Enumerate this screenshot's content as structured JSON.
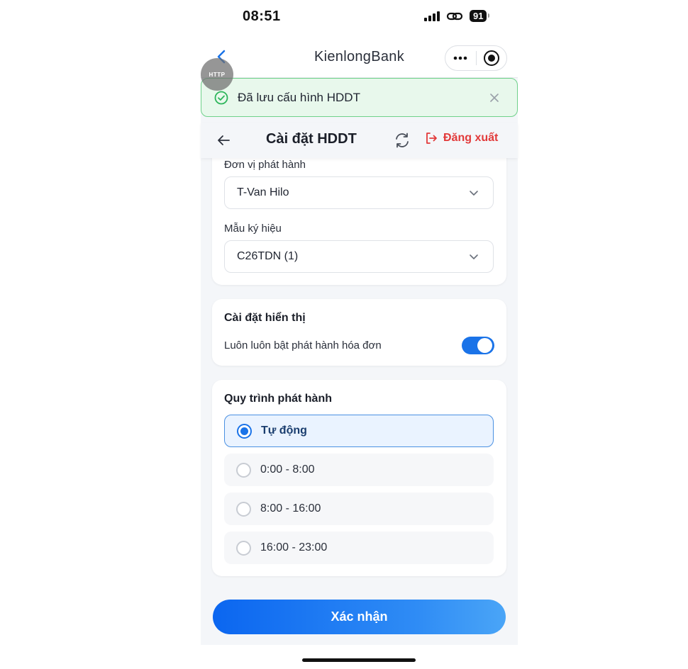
{
  "status_bar": {
    "time": "08:51",
    "battery": "91"
  },
  "mini_app": {
    "title": "KienlongBank",
    "http_badge": "HTTP"
  },
  "toast": {
    "message": "Đã lưu cấu hình HDDT"
  },
  "header": {
    "title": "Cài đặt HDDT",
    "logout_label": "Đăng xuất"
  },
  "issuer_card": {
    "issuer_label": "Đơn vị phát hành",
    "issuer_value": "T-Van Hilo",
    "template_label": "Mẫu ký hiệu",
    "template_value": "C26TDN (1)"
  },
  "display_card": {
    "title": "Cài đặt hiển thị",
    "toggle_label": "Luôn luôn bật phát hành hóa đơn",
    "toggle_on": true
  },
  "process_card": {
    "title": "Quy trình phát hành",
    "options": [
      {
        "label": "Tự động",
        "selected": true
      },
      {
        "label": "0:00 - 8:00",
        "selected": false
      },
      {
        "label": "8:00 - 16:00",
        "selected": false
      },
      {
        "label": "16:00 - 23:00",
        "selected": false
      }
    ]
  },
  "confirm_label": "Xác nhận",
  "colors": {
    "accent": "#1a73e8",
    "success": "#2cb55a",
    "danger": "#e23a3a"
  }
}
